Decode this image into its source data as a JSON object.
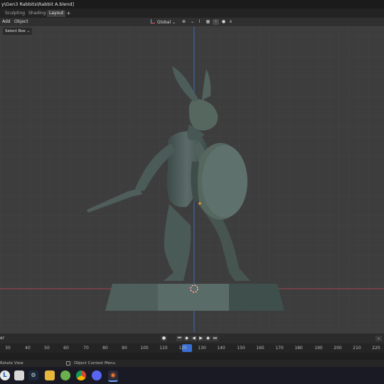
{
  "window": {
    "title": "y\\Gen3 Rabbits\\Rabbit A.blend]"
  },
  "workspace_tabs": [
    {
      "label": "Sculpting",
      "active": false
    },
    {
      "label": "Shading",
      "active": false
    },
    {
      "label": "Layout",
      "active": true
    }
  ],
  "header": {
    "menu_add": "Add",
    "menu_object": "Object",
    "orientation": "Global"
  },
  "select_box": "Select Box",
  "playback": {
    "editor_label": "er",
    "current_frame": "120"
  },
  "ruler": {
    "ticks": [
      "30",
      "40",
      "50",
      "60",
      "70",
      "80",
      "90",
      "100",
      "110",
      "120",
      "130",
      "140",
      "150",
      "160",
      "170",
      "180",
      "190",
      "200",
      "210",
      "220"
    ]
  },
  "status": {
    "left": "Rotate View",
    "middle": "Object Context Menu"
  },
  "taskbar_icons": [
    "app-l-icon",
    "files-icon",
    "steam-icon",
    "folder-icon",
    "game-icon",
    "chrome-icon",
    "discord-icon",
    "blender-icon"
  ],
  "colors": {
    "accent": "#3a6fd3",
    "axis_x": "#a44553",
    "axis_z": "#3b6db8",
    "model": "#50605d"
  }
}
